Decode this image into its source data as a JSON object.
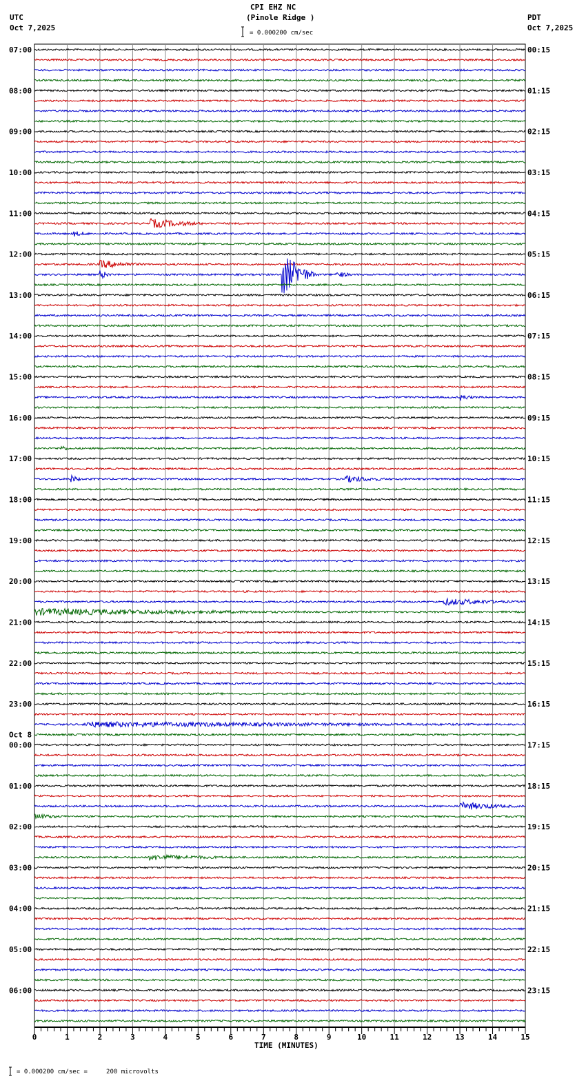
{
  "header": {
    "station": "CPI EHZ NC",
    "site": "(Pinole Ridge )",
    "left_tz": "UTC",
    "left_date": "Oct 7,2025",
    "right_tz": "PDT",
    "right_date": "Oct 7,2025",
    "scale_text": "= 0.000200 cm/sec"
  },
  "footer": {
    "scale_text": "= 0.000200 cm/sec =     200 microvolts"
  },
  "chart_data": {
    "type": "line",
    "title": "CPI EHZ NC (Pinole Ridge )",
    "xlabel": "TIME (MINUTES)",
    "xlim": [
      0,
      15
    ],
    "x_ticks": [
      "0",
      "1",
      "2",
      "3",
      "4",
      "5",
      "6",
      "7",
      "8",
      "9",
      "10",
      "11",
      "12",
      "13",
      "14",
      "15"
    ],
    "trace_colors": [
      "#000000",
      "#cc0000",
      "#0000cc",
      "#006600"
    ],
    "traces_per_hour": 4,
    "left_labels": [
      "07:00",
      "08:00",
      "09:00",
      "10:00",
      "11:00",
      "12:00",
      "13:00",
      "14:00",
      "15:00",
      "16:00",
      "17:00",
      "18:00",
      "19:00",
      "20:00",
      "21:00",
      "22:00",
      "23:00",
      "00:00",
      "01:00",
      "02:00",
      "03:00",
      "04:00",
      "05:00",
      "06:00"
    ],
    "date_change_label": "Oct 8",
    "date_change_index": 17,
    "right_labels": [
      "00:15",
      "01:15",
      "02:15",
      "03:15",
      "04:15",
      "05:15",
      "06:15",
      "07:15",
      "08:15",
      "09:15",
      "10:15",
      "11:15",
      "12:15",
      "13:15",
      "14:15",
      "15:15",
      "16:15",
      "17:15",
      "18:15",
      "19:15",
      "20:15",
      "21:15",
      "22:15",
      "23:15"
    ],
    "events": [
      {
        "trace": 17,
        "minute": 3.5,
        "amplitude": 6,
        "duration": 2.0
      },
      {
        "trace": 21,
        "minute": 2.0,
        "amplitude": 5,
        "duration": 1.5
      },
      {
        "trace": 22,
        "minute": 2.0,
        "amplitude": 6,
        "duration": 0.4
      },
      {
        "trace": 22,
        "minute": 7.55,
        "amplitude": 30,
        "duration": 1.2
      },
      {
        "trace": 22,
        "minute": 9.2,
        "amplitude": 4,
        "duration": 0.6
      },
      {
        "trace": 18,
        "minute": 1.2,
        "amplitude": 3,
        "duration": 0.6
      },
      {
        "trace": 34,
        "minute": 13.0,
        "amplitude": 4,
        "duration": 0.5
      },
      {
        "trace": 39,
        "minute": 0.8,
        "amplitude": 4,
        "duration": 0.3
      },
      {
        "trace": 42,
        "minute": 1.1,
        "amplitude": 5,
        "duration": 0.4
      },
      {
        "trace": 42,
        "minute": 9.5,
        "amplitude": 4,
        "duration": 1.5
      },
      {
        "trace": 54,
        "minute": 12.5,
        "amplitude": 4,
        "duration": 2.5
      },
      {
        "trace": 55,
        "minute": 0.0,
        "amplitude": 4,
        "duration": 9.0
      },
      {
        "trace": 66,
        "minute": 1.5,
        "amplitude": 3,
        "duration": 13.5
      },
      {
        "trace": 74,
        "minute": 13.0,
        "amplitude": 5,
        "duration": 2.0
      },
      {
        "trace": 75,
        "minute": 0.0,
        "amplitude": 3,
        "duration": 1.0
      },
      {
        "trace": 79,
        "minute": 3.5,
        "amplitude": 3,
        "duration": 3.0
      }
    ]
  }
}
